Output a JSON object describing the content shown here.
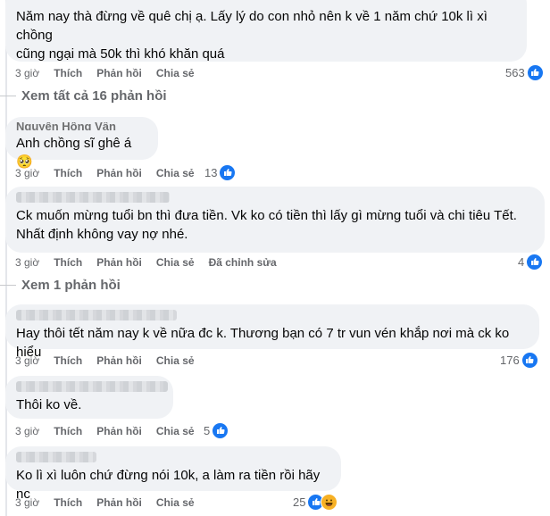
{
  "comments": [
    {
      "text_lines": [
        "Năm nay thà đừng về quê chị ạ. Lấy lý do con nhỏ nên k về 1 năm chứ 10k lì xì chồng",
        "cũng ngại mà 50k thì khó khăn quá"
      ],
      "time": "3 giờ",
      "like": "Thích",
      "reply": "Phản hồi",
      "share": "Chia sẻ",
      "count": "563"
    },
    {
      "author_partial": "Nguyễn Hồng Vân",
      "text_lines": [
        "Anh chồng sĩ ghê á 🥺"
      ],
      "time": "3 giờ",
      "like": "Thích",
      "reply": "Phản hồi",
      "share": "Chia sẻ",
      "count": "13"
    },
    {
      "text_lines": [
        "Ck muốn mừng tuổi bn thì đưa tiền. Vk ko có tiền thì lấy gì mừng tuổi và chi tiêu Tết.",
        "Nhất định không vay nợ nhé."
      ],
      "time": "3 giờ",
      "like": "Thích",
      "reply": "Phản hồi",
      "share": "Chia sẻ",
      "edited": "Đã chỉnh sửa",
      "count": "4"
    },
    {
      "text_lines": [
        "Hay thôi tết năm nay k về nữa đc k. Thương bạn có 7 tr vun vén khắp nơi mà ck ko hiểu"
      ],
      "time": "3 giờ",
      "like": "Thích",
      "reply": "Phản hồi",
      "share": "Chia sẻ",
      "count": "176"
    },
    {
      "text_lines": [
        "Thôi ko về."
      ],
      "time": "3 giờ",
      "like": "Thích",
      "reply": "Phản hồi",
      "share": "Chia sẻ",
      "count": "5"
    },
    {
      "text_lines": [
        "Ko lì xì luôn chứ đừng nói 10k, a làm ra tiền rồi hãy nc"
      ],
      "time": "3 giờ",
      "like": "Thích",
      "reply": "Phản hồi",
      "share": "Chia sẻ",
      "count": "25"
    }
  ],
  "view_replies_16": "Xem tất cả 16 phản hồi",
  "view_replies_1": "Xem 1 phản hồi",
  "icons": {
    "like": "like-icon",
    "haha": "haha-icon"
  },
  "colors": {
    "like_blue": "#1877f2",
    "bubble_bg": "#f0f2f5",
    "meta_gray": "#65676b"
  }
}
